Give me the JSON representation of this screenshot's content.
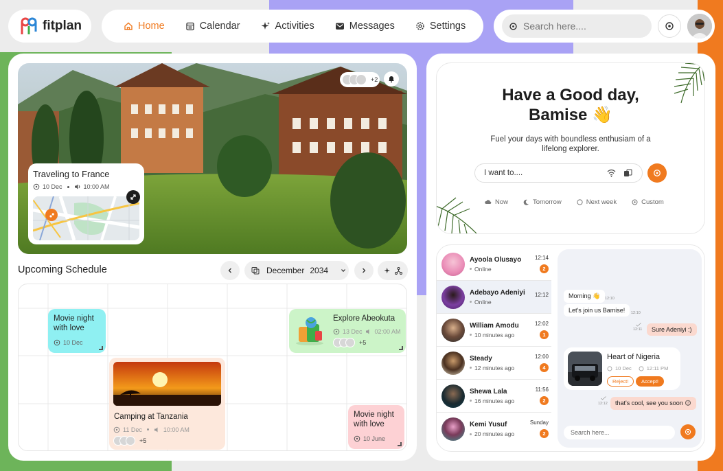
{
  "brand": {
    "name": "fitplan",
    "accent": "#f07a1f"
  },
  "nav": {
    "items": [
      {
        "label": "Home",
        "icon": "home-icon",
        "active": true
      },
      {
        "label": "Calendar",
        "icon": "calendar-icon",
        "active": false
      },
      {
        "label": "Activities",
        "icon": "sparkle-icon",
        "active": false
      },
      {
        "label": "Messages",
        "icon": "message-icon",
        "active": false
      },
      {
        "label": "Settings",
        "icon": "gear-icon",
        "active": false
      }
    ]
  },
  "search": {
    "placeholder": "Search here...."
  },
  "hero": {
    "participants_more": "+2",
    "travel": {
      "title": "Traveling to France",
      "date": "10 Dec",
      "time": "10:00 AM"
    }
  },
  "schedule": {
    "title": "Upcoming Schedule",
    "month": "December",
    "year": "2034",
    "events": [
      {
        "title": "Movie night with love",
        "date": "10 Dec",
        "color": "#8ff0f2"
      },
      {
        "title": "Explore Abeokuta",
        "date": "13 Dec",
        "time": "02:00 AM",
        "more": "+5",
        "color": "#ccf4c8"
      },
      {
        "title": "Camping at Tanzania",
        "date": "11 Dec",
        "time": "10:00 AM",
        "more": "+5",
        "color": "#fde8dc"
      },
      {
        "title": "Movie night with love",
        "date": "10 June",
        "color": "#fdd1d4"
      }
    ]
  },
  "greeting": {
    "title_line1": "Have a Good day,",
    "title_line2": "Bamise",
    "emoji": "👋",
    "subtitle_line1": "Fuel your days with boundless enthusiam of a",
    "subtitle_line2": "lifelong explorer.",
    "input_placeholder": "I want to....",
    "chips": [
      {
        "label": "Now",
        "icon": "cloud-icon"
      },
      {
        "label": "Tomorrow",
        "icon": "moon-icon"
      },
      {
        "label": "Next week",
        "icon": "clock-icon"
      },
      {
        "label": "Custom",
        "icon": "target-icon"
      }
    ]
  },
  "contacts": [
    {
      "name": "Ayoola Olusayo",
      "status": "Online",
      "time": "12:14",
      "unread": "2",
      "color": "#e98ab5"
    },
    {
      "name": "Adebayo Adeniyi",
      "status": "Online",
      "time": "12:12",
      "unread": "",
      "color": "#7b3fa0"
    },
    {
      "name": "William Amodu",
      "status": "10 minutes ago",
      "time": "12:02",
      "unread": "1",
      "color": "#2d2d2d"
    },
    {
      "name": "Steady",
      "status": "12 minutes ago",
      "time": "12:00",
      "unread": "4",
      "color": "#3a3a3a"
    },
    {
      "name": "Shewa Lala",
      "status": "16 minutes ago",
      "time": "11:56",
      "unread": "2",
      "color": "#0e3a4a"
    },
    {
      "name": "Kemi Yusuf",
      "status": "20 minutes ago",
      "time": "Sunday",
      "unread": "2",
      "color": "#3a8f8a"
    }
  ],
  "chat": {
    "messages": [
      {
        "text": "Morning 👋",
        "time": "12:10",
        "dir": "in"
      },
      {
        "text": "Let's join us Bamise!",
        "time": "12:10",
        "dir": "in"
      },
      {
        "text": "Sure Adeniyi :)",
        "time": "12:11",
        "dir": "out"
      },
      {
        "text": "that's cool, see you soon 😉",
        "time": "12:12",
        "dir": "out"
      }
    ],
    "invite": {
      "title": "Heart of Nigeria",
      "date": "10 Dec",
      "time": "12:11 PM",
      "reject": "Reject!",
      "accept": "Accept!"
    },
    "search_placeholder": "Search here..."
  }
}
